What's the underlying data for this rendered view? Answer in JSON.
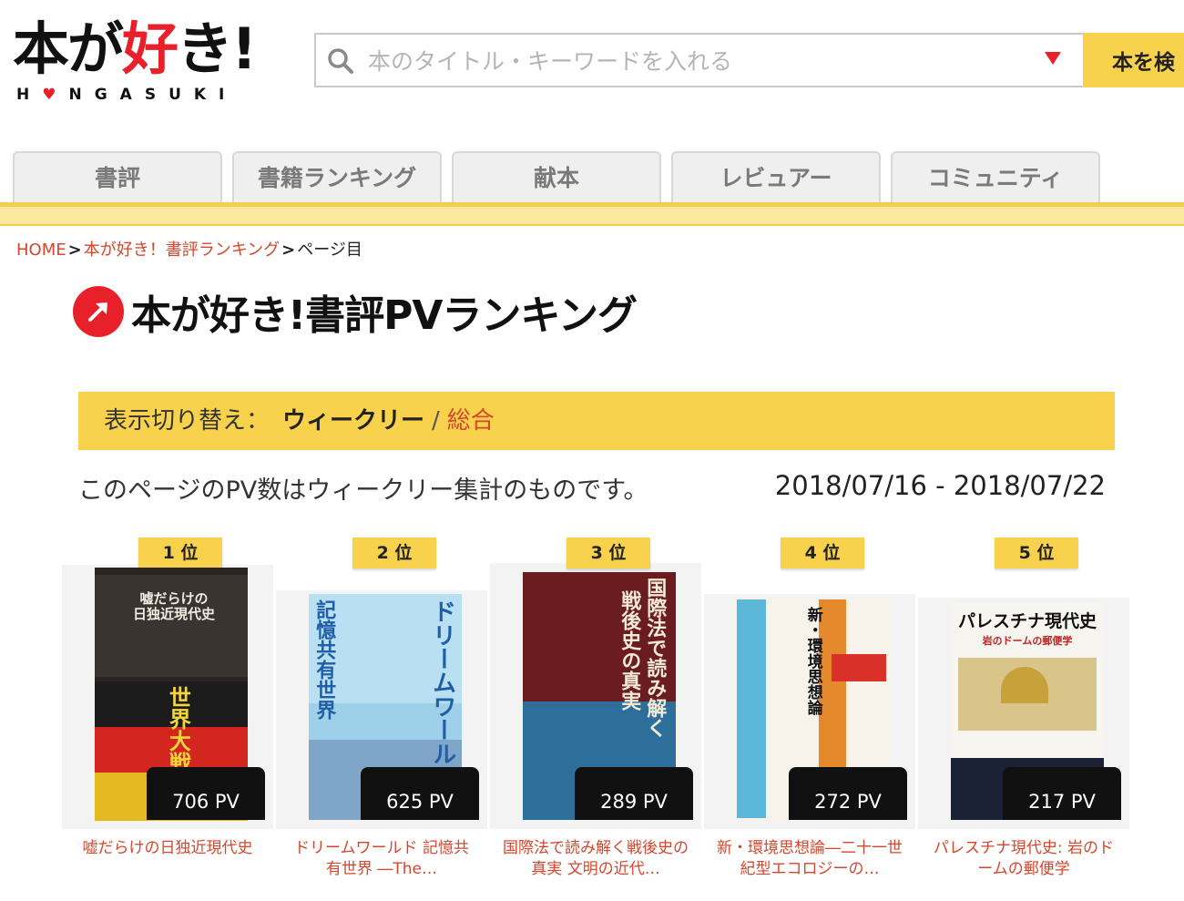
{
  "logo": {
    "main_black1": "本が",
    "main_red": "好",
    "main_black2": "き!",
    "sub_pre": "H",
    "sub_heart": "♥",
    "sub_post": "NGASUKI"
  },
  "search": {
    "placeholder": "本のタイトル・キーワードを入れる",
    "button_label": "本を検"
  },
  "nav": {
    "tabs": [
      "書評",
      "書籍ランキング",
      "献本",
      "レビュアー",
      "コミュニティ"
    ]
  },
  "breadcrumb": {
    "home": "HOME",
    "sep": ">",
    "ranking": "本が好き！書評ランキング",
    "current": "ページ目"
  },
  "page_title": "本が好き!書評PVランキング",
  "switcher": {
    "label": "表示切り替え：",
    "weekly": "ウィークリー",
    "slash": "/",
    "total": "総合"
  },
  "note": "このページのPV数はウィークリー集計のものです。",
  "date_range": "2018/07/16 - 2018/07/22",
  "colors": {
    "brand_red": "#e8202a",
    "accent_yellow": "#f8d24c",
    "link": "#d4472d"
  },
  "ranking": [
    {
      "rank": "1 位",
      "pv": "706 PV",
      "title_line1": "嘘だらけの日独近現代史",
      "title_line2": "",
      "cover_text": "嘘だらけの\n日独近現代史",
      "cover_accent": "世界大戦"
    },
    {
      "rank": "2 位",
      "pv": "625 PV",
      "title_line1": "ドリームワールド 記憶共",
      "title_line2": "有世界 ―The…",
      "cover_text": "ドリームワールド",
      "cover_accent": "記憶共有世界"
    },
    {
      "rank": "3 位",
      "pv": "289 PV",
      "title_line1": "国際法で読み解く戦後史の",
      "title_line2": "真実 文明の近代…",
      "cover_text": "国際法で読み解く",
      "cover_accent": "戦後史の真実"
    },
    {
      "rank": "4 位",
      "pv": "272 PV",
      "title_line1": "新・環境思想論―二十一世",
      "title_line2": "紀型エコロジーの…",
      "cover_text": "新・環境思想論",
      "cover_accent": ""
    },
    {
      "rank": "5 位",
      "pv": "217 PV",
      "title_line1": "パレスチナ現代史: 岩のド",
      "title_line2": "ームの郵便学",
      "cover_text": "パレスチナ現代史",
      "cover_accent": "岩のドームの郵便学"
    }
  ]
}
